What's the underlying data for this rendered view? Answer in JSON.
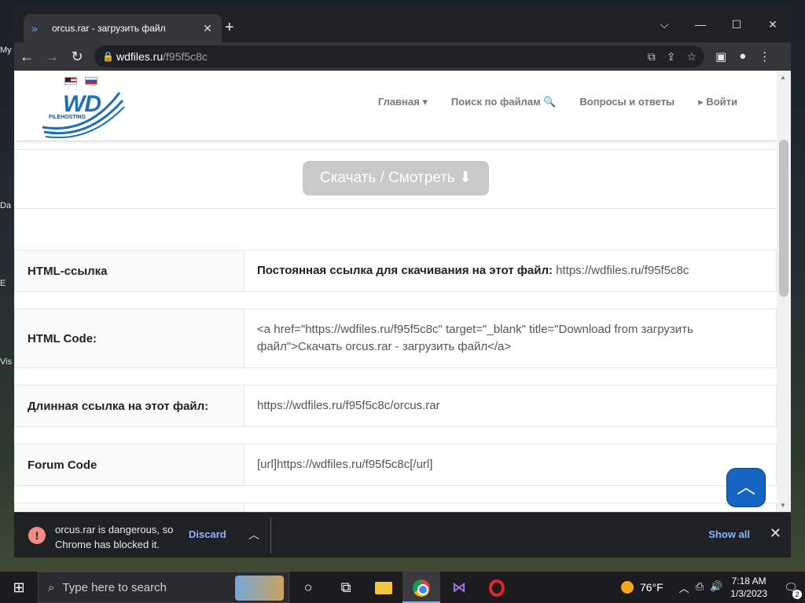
{
  "browser": {
    "tab_title": "orcus.rar - загрузить файл",
    "tab_close": "✕",
    "new_tab": "+",
    "window_controls": {
      "dropdown": "⌵",
      "minimize": "—",
      "maximize": "☐",
      "close": "✕"
    },
    "nav": {
      "back": "←",
      "forward": "→",
      "reload": "↻"
    },
    "url_host": "wdfiles.ru",
    "url_path": "/f95f5c8c"
  },
  "site": {
    "logo_text": "WD",
    "logo_sub": "FILEHOSTING",
    "nav": [
      {
        "label": "Главная ▾"
      },
      {
        "label": "Поиск по файлам 🔍"
      },
      {
        "label": "Вопросы и ответы"
      },
      {
        "label": "▸ Войти"
      }
    ],
    "download_button": "Скачать / Смотреть ⬇"
  },
  "rows": [
    {
      "label": "HTML-ссылка",
      "strong": "Постоянная ссылка для скачивания на этот файл:",
      "value": " https://wdfiles.ru/f95f5c8c"
    },
    {
      "label": "HTML Code:",
      "value": "<a href=\"https://wdfiles.ru/f95f5c8c\" target=\"_blank\" title=\"Download from загрузить файл\">Скачать orcus.rar - загрузить файл</a>"
    },
    {
      "label": "Длинная ссылка на этот файл:",
      "value": "https://wdfiles.ru/f95f5c8c/orcus.rar"
    },
    {
      "label": "Forum Code",
      "value": "[url]https://wdfiles.ru/f95f5c8c[/url]"
    }
  ],
  "to_top": "︿",
  "download_bar": {
    "message_line1": "orcus.rar is dangerous, so",
    "message_line2": "Chrome has blocked it.",
    "discard": "Discard",
    "show_all": "Show all",
    "close": "✕"
  },
  "taskbar": {
    "search_placeholder": "Type here to search",
    "temperature": "76°F",
    "time": "7:18 AM",
    "date": "1/3/2023",
    "notifications": "2"
  },
  "desktop_labels": [
    "My",
    "Da",
    "E",
    "Vis"
  ]
}
